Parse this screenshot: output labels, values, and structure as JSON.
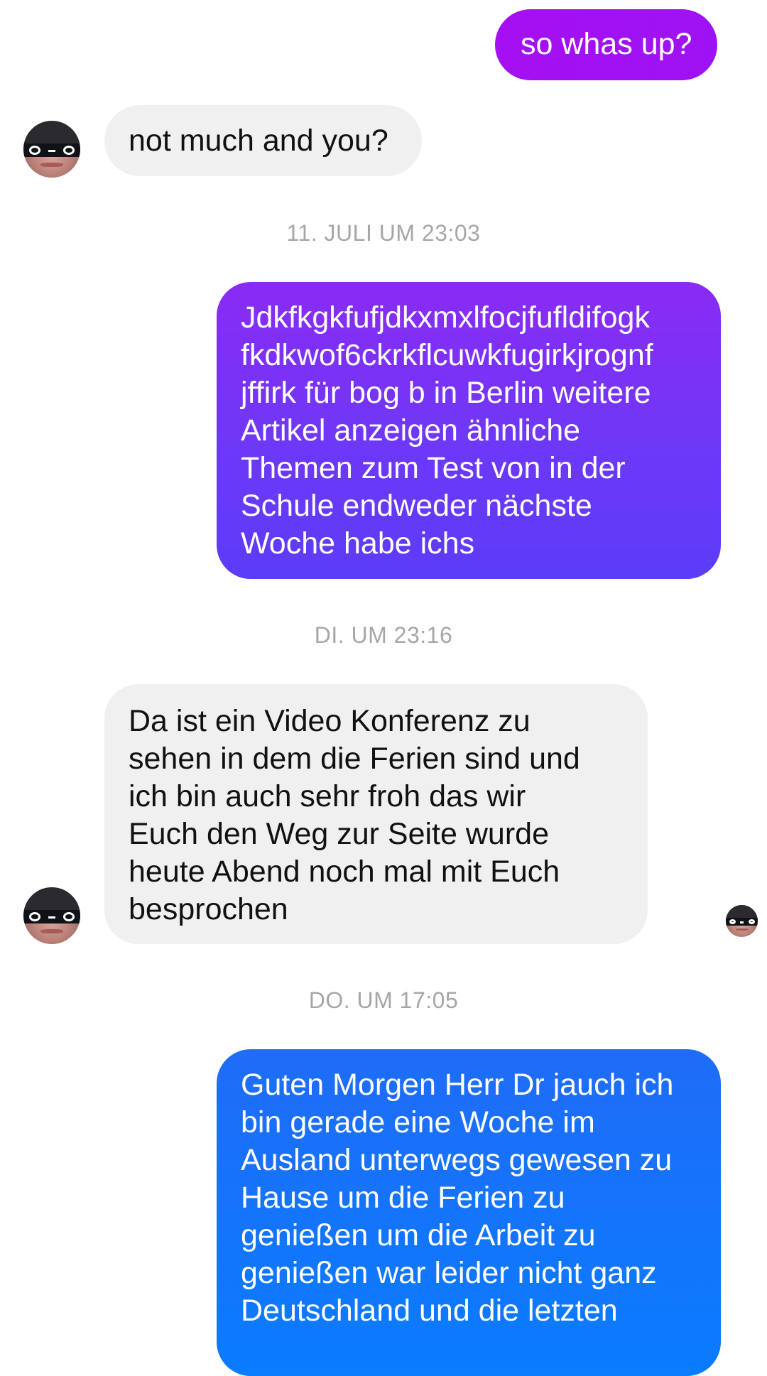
{
  "messages": [
    {
      "direction": "outgoing",
      "text": "so whas up?"
    },
    {
      "direction": "incoming",
      "text": "not much and you?"
    },
    {
      "direction": "outgoing",
      "text": "Jdkfkgkfufjdkxmxlfocjfufldifogk\nfkdkwof6ckrkflcuwkfugirkjrognf\njffirk für  bog b in  Berlin  weitere\nArtikel  anzeigen  ähnliche\nThemen zum Test von in der\nSchule endweder nächste\nWoche habe ichs"
    },
    {
      "direction": "incoming",
      "text": "Da ist ein Video Konferenz zu\nsehen in dem die Ferien sind und\nich bin auch sehr froh das wir\nEuch den Weg zur Seite wurde\nheute Abend noch mal mit Euch\nbesprochen"
    },
    {
      "direction": "outgoing",
      "text": "Guten Morgen Herr Dr jauch ich\nbin gerade eine Woche im\nAusland unterwegs gewesen zu\nHause um die Ferien zu\ngenießen um die Arbeit zu\ngenießen war leider nicht ganz\nDeutschland und die letzten"
    }
  ],
  "timestamps": [
    "11. JULI UM 23:03",
    "DI. UM 23:16",
    "DO. UM 17:05"
  ],
  "colors": {
    "outgoing_purple": "#a510f2",
    "outgoing_violet": "#6e38f7",
    "outgoing_blue": "#0a7cff",
    "incoming_gray": "#f0f0f0",
    "timestamp_gray": "#a6a6a6"
  },
  "icons": {
    "contact_avatar": "masked-face-avatar",
    "read_receipt": "masked-face-avatar-small"
  }
}
